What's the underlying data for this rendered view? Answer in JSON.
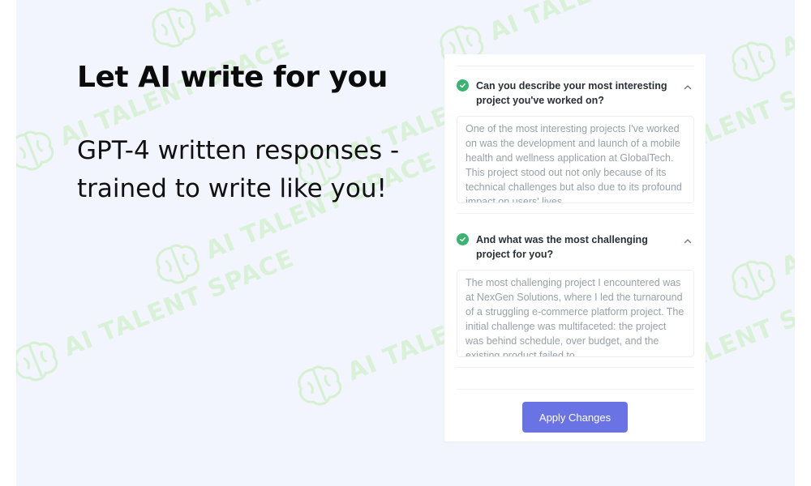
{
  "hero": {
    "headline": "Let AI write for you",
    "subtext": "GPT-4 written responses - trained to write like you!"
  },
  "watermark": {
    "text": "AI TALENT SPACE",
    "icon": "brain-icon"
  },
  "card": {
    "items": [
      {
        "question": "Can you describe your most interesting project you've worked on?",
        "answer": "One of the most interesting projects I've worked on was the development and launch of a mobile health and wellness application at GlobalTech. This project stood out not only because of its technical challenges but also due to its profound impact on users' lives.",
        "status_icon": "check-circle-icon",
        "toggle_icon": "chevron-up-icon"
      },
      {
        "question": "And what was the most challenging project for you?",
        "answer": "The most challenging project I encountered was at NexGen Solutions, where I led the turnaround of a struggling e-commerce platform project. The initial challenge was multifaceted: the project was behind schedule, over budget, and the existing product failed to",
        "status_icon": "check-circle-icon",
        "toggle_icon": "chevron-up-icon"
      }
    ],
    "apply_label": "Apply Changes"
  },
  "colors": {
    "background": "#f2f5fd",
    "accent_button": "#6a73e4",
    "check_green": "#3cb371",
    "watermark_green": "#a0eb82"
  }
}
